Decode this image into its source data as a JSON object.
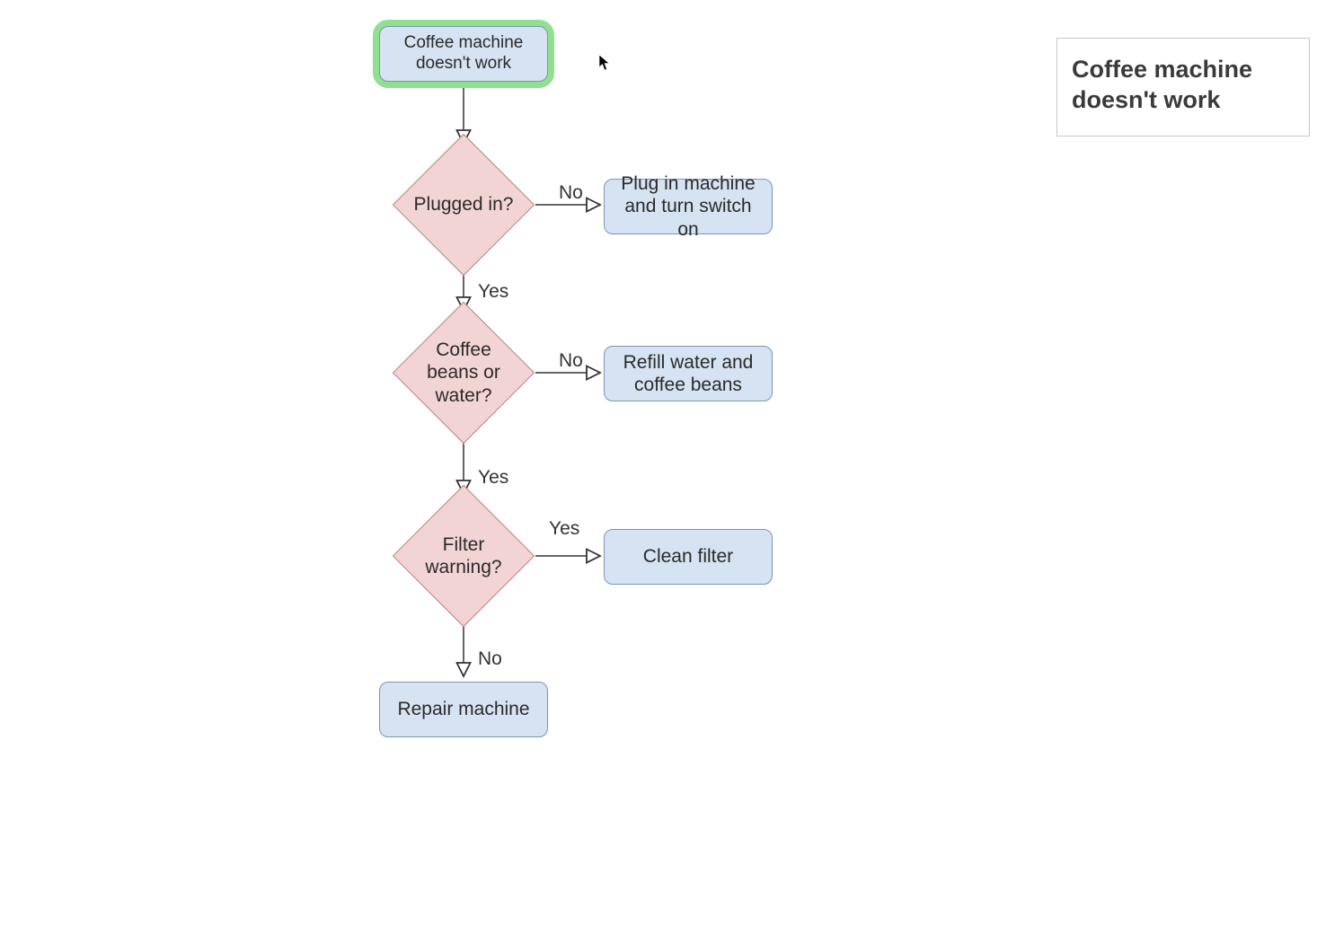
{
  "nodes": {
    "start": {
      "label": "Coffee machine doesn't work"
    },
    "plugged_in": {
      "label": "Plugged in?"
    },
    "plug_in": {
      "label": "Plug in machine and turn switch on"
    },
    "beans_water": {
      "label": "Coffee beans or water?"
    },
    "refill": {
      "label": "Refill water and coffee beans"
    },
    "filter": {
      "label": "Filter warning?"
    },
    "clean_filter": {
      "label": "Clean filter"
    },
    "repair": {
      "label": "Repair machine"
    }
  },
  "edges": {
    "plugged_in_no": "No",
    "plugged_in_yes": "Yes",
    "beans_water_no": "No",
    "beans_water_yes": "Yes",
    "filter_yes": "Yes",
    "filter_no": "No"
  },
  "side_panel": {
    "title": "Coffee machine doesn't work"
  },
  "selected_node": "start"
}
